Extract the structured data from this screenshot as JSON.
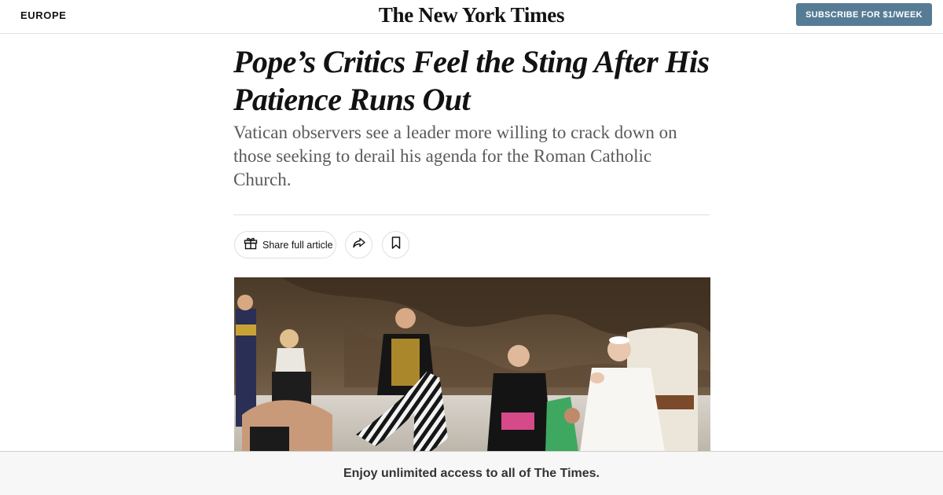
{
  "header": {
    "section": "EUROPE",
    "masthead": "The New York Times",
    "subscribe_label": "SUBSCRIBE FOR $1/WEEK"
  },
  "article": {
    "headline": "Pope’s Critics Feel the Sting After His Patience Runs Out",
    "summary": "Vatican observers see a leader more willing to crack down on those seeking to derail his agenda for the Roman Catholic Church."
  },
  "actions": {
    "share_label": "Share full article",
    "share_icon": "gift-icon",
    "forward_icon": "share-arrow-icon",
    "save_icon": "bookmark-icon"
  },
  "banner": {
    "text": "Enjoy unlimited access to all of The Times."
  },
  "colors": {
    "subscribe_bg": "#567b95",
    "text": "#121212",
    "summary_text": "#5a5a5a"
  }
}
